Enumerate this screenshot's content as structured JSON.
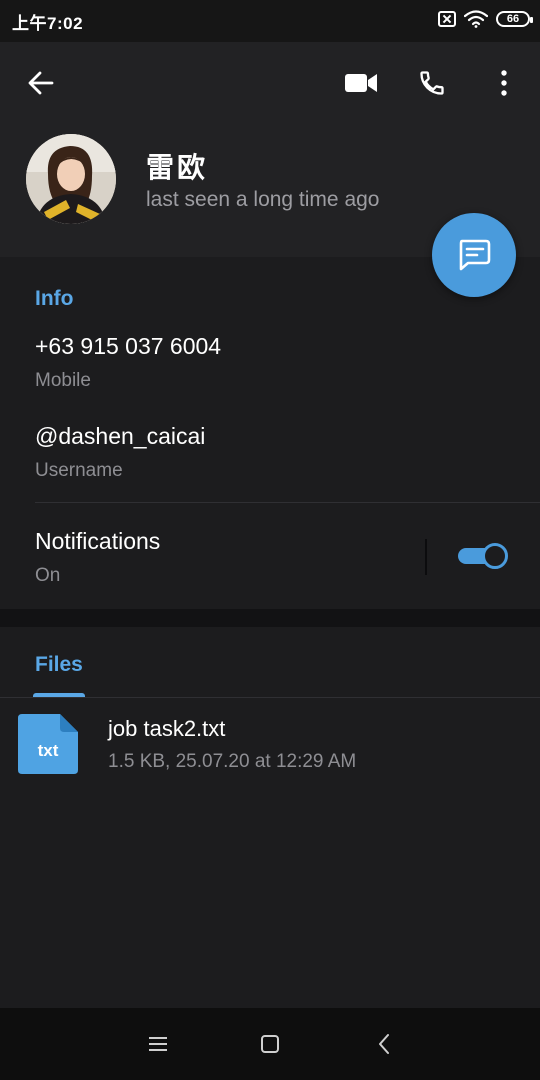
{
  "status_bar": {
    "time": "上午7:02",
    "battery": "66",
    "icons": [
      "sim-off-icon",
      "wifi-icon",
      "battery-icon"
    ]
  },
  "app_bar": {
    "icons": [
      "back-arrow-icon",
      "video-camera-icon",
      "phone-icon",
      "more-vertical-icon"
    ]
  },
  "profile": {
    "name": "雷欧",
    "status": "last seen a long time ago"
  },
  "fab": {
    "icon": "message-icon"
  },
  "info": {
    "title": "Info",
    "phone": {
      "value": "+63 915 037 6004",
      "label": "Mobile"
    },
    "username": {
      "value": "@dashen_caicai",
      "label": "Username"
    },
    "notifications": {
      "title": "Notifications",
      "state": "On",
      "enabled": true
    }
  },
  "files": {
    "tab_label": "Files",
    "items": [
      {
        "icon_label": "txt",
        "name": "job task2.txt",
        "meta": "1.5 KB, 25.07.20 at 12:29 AM"
      }
    ]
  },
  "nav_bar": {
    "icons": [
      "menu-icon",
      "home-icon",
      "back-icon"
    ]
  },
  "colors": {
    "accent": "#5aa7e6",
    "fab": "#4a9bdc",
    "background": "#1c1c1e",
    "header": "#222224",
    "secondary_text": "#8e8e93",
    "file_icon": "#4fa3e3"
  }
}
